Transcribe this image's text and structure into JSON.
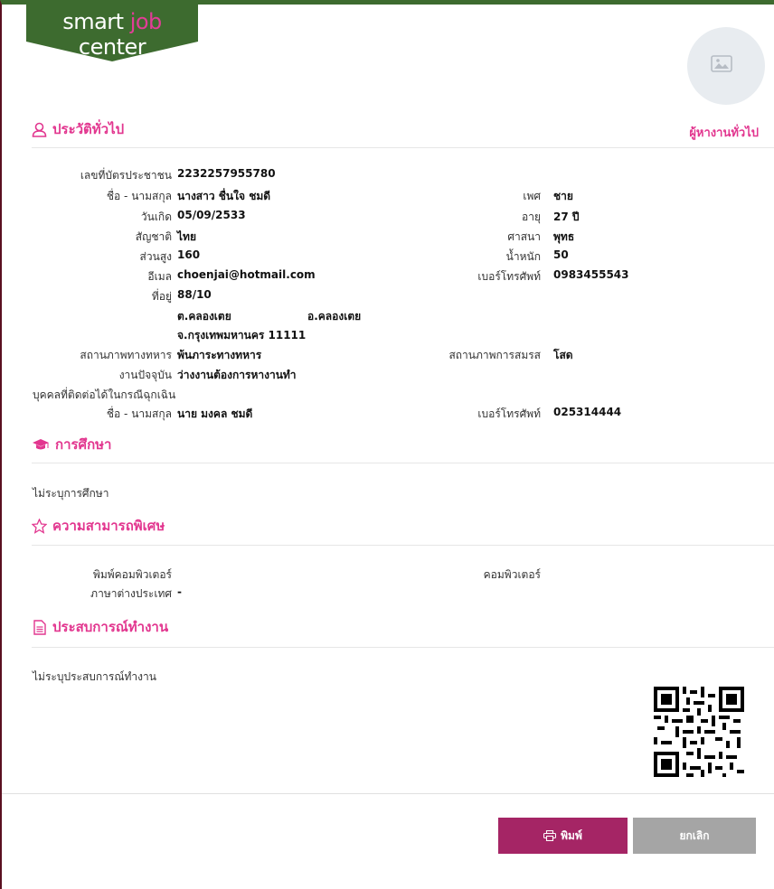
{
  "brand": {
    "part1": "smart ",
    "part2": "job",
    "part3": " center"
  },
  "colors": {
    "accent": "#e2368f",
    "print_button": "#a52565",
    "cancel_button": "#a5a5a5",
    "logo_green": "#3d6b2f"
  },
  "applicant_type": "ผู้หางานทั่วไป",
  "general": {
    "title": "ประวัติทั่วไป",
    "id_label": "เลขที่บัตรประชาชน",
    "id_value": "2232257955780",
    "name_label": "ชื่อ - นามสกุล",
    "name_value": "นางสาว ชื่นใจ ชมดี",
    "gender_label": "เพศ",
    "gender_value": "ชาย",
    "birth_label": "วันเกิด",
    "birth_value": "05/09/2533",
    "age_label": "อายุ",
    "age_value": "27 ปี",
    "nationality_label": "สัญชาติ",
    "nationality_value": "ไทย",
    "religion_label": "ศาสนา",
    "religion_value": "พุทธ",
    "height_label": "ส่วนสูง",
    "height_value": "160",
    "weight_label": "น้ำหนัก",
    "weight_value": "50",
    "email_label": "อีเมล",
    "email_value": "choenjai@hotmail.com",
    "phone_label": "เบอร์โทรศัพท์",
    "phone_value": "0983455543",
    "address_label": "ที่อยู่",
    "address_line1": "88/10",
    "subdistrict": "ต.คลองเตย",
    "district": "อ.คลองเตย",
    "province": "จ.กรุงเทพมหานคร 11111",
    "military_label": "สถานภาพทางทหาร",
    "military_value": "พ้นภาระทางทหาร",
    "marital_label": "สถานภาพการสมรส",
    "marital_value": "โสด",
    "current_job_label": "งานปัจจุบัน",
    "current_job_value": "ว่างงานต้องการหางานทำ",
    "emergency_label": "บุคคลที่ติดต่อได้ในกรณีฉุกเฉิน",
    "emergency_name_label": "ชื่อ - นามสกุล",
    "emergency_name_value": "นาย มงคล ชมดี",
    "emergency_phone_label": "เบอร์โทรศัพท์",
    "emergency_phone_value": "025314444"
  },
  "education": {
    "title": "การศึกษา",
    "empty_text": "ไม่ระบุการศึกษา"
  },
  "skills": {
    "title": "ความสามารถพิเศษ",
    "typing_label": "พิมพ์คอมพิวเตอร์",
    "computer_label": "คอมพิวเตอร์",
    "language_label": "ภาษาต่างประเทศ",
    "language_value": "-"
  },
  "experience": {
    "title": "ประสบการณ์ทำงาน",
    "empty_text": "ไม่ระบุประสบการณ์ทำงาน"
  },
  "buttons": {
    "print": "พิมพ์",
    "cancel": "ยกเลิก"
  },
  "icons": {
    "general": "user-icon",
    "education": "graduation-cap-icon",
    "skills": "star-icon",
    "experience": "document-icon",
    "print": "printer-icon",
    "photo": "image-placeholder-icon"
  }
}
